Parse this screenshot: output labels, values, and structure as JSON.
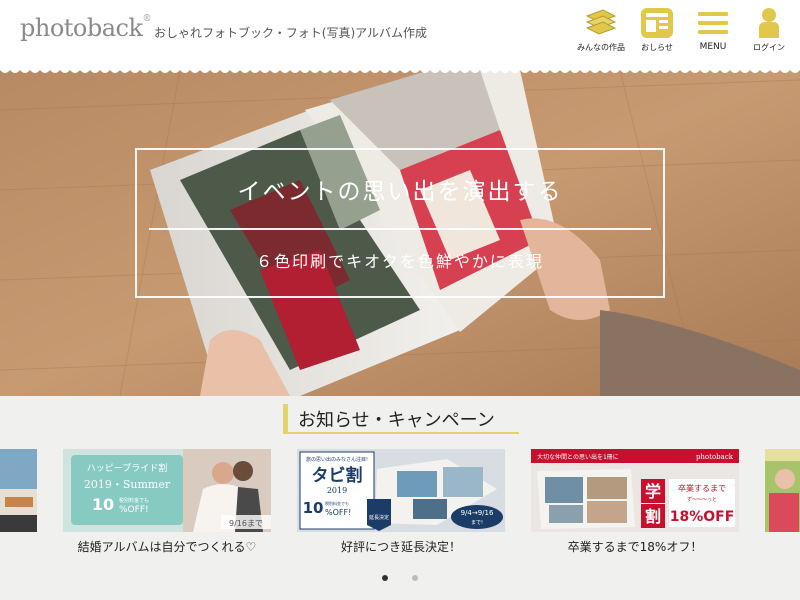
{
  "header": {
    "logo": "photoback",
    "logo_mark": "®",
    "tagline": "おしゃれフォトブック・フォト(写真)アルバム作成",
    "nav": [
      {
        "label": "みんなの作品",
        "icon": "books-icon"
      },
      {
        "label": "おしらせ",
        "icon": "news-icon"
      },
      {
        "label": "MENU",
        "icon": "hamburger-icon"
      },
      {
        "label": "ログイン",
        "icon": "user-icon"
      }
    ]
  },
  "hero": {
    "title": "イベントの思い出を演出する",
    "subtitle": "６色印刷でキオクを色鮮やかに表現"
  },
  "news": {
    "title": "お知らせ・キャンペーン",
    "cards": [
      {
        "caption": "結婚アルバムは自分でつくれる♡",
        "img": {
          "line1": "ハッピーブライド割",
          "line2": "2019・Summer",
          "pct": "10",
          "unit": "%OFF!",
          "small": "税別料金でも",
          "date": "9/16まで"
        }
      },
      {
        "caption": "好評につき延長決定！",
        "img": {
          "top": "旅の思い出のみなさん注目!",
          "title": "タビ割",
          "year": "2019",
          "pct": "10",
          "unit": "%OFF!",
          "small": "税別料金でも",
          "badge": "延長決定",
          "date": "9/4→9/16",
          "date2": "まで!"
        }
      },
      {
        "caption": "卒業するまで18%オフ！",
        "img": {
          "top": "大切な仲間との思い出を1冊に",
          "brand": "photoback",
          "kanji1": "学",
          "kanji2": "割",
          "line1": "卒業するまで",
          "line2": "ず～～～っと",
          "pct": "18%OFF"
        }
      }
    ],
    "dots": 2,
    "active_dot": 0
  },
  "colors": {
    "accent": "#e2d36d",
    "icon_yellow": "#e1c84a",
    "campaign_red": "#c8102e",
    "bridal_teal": "#7ec6bf"
  }
}
